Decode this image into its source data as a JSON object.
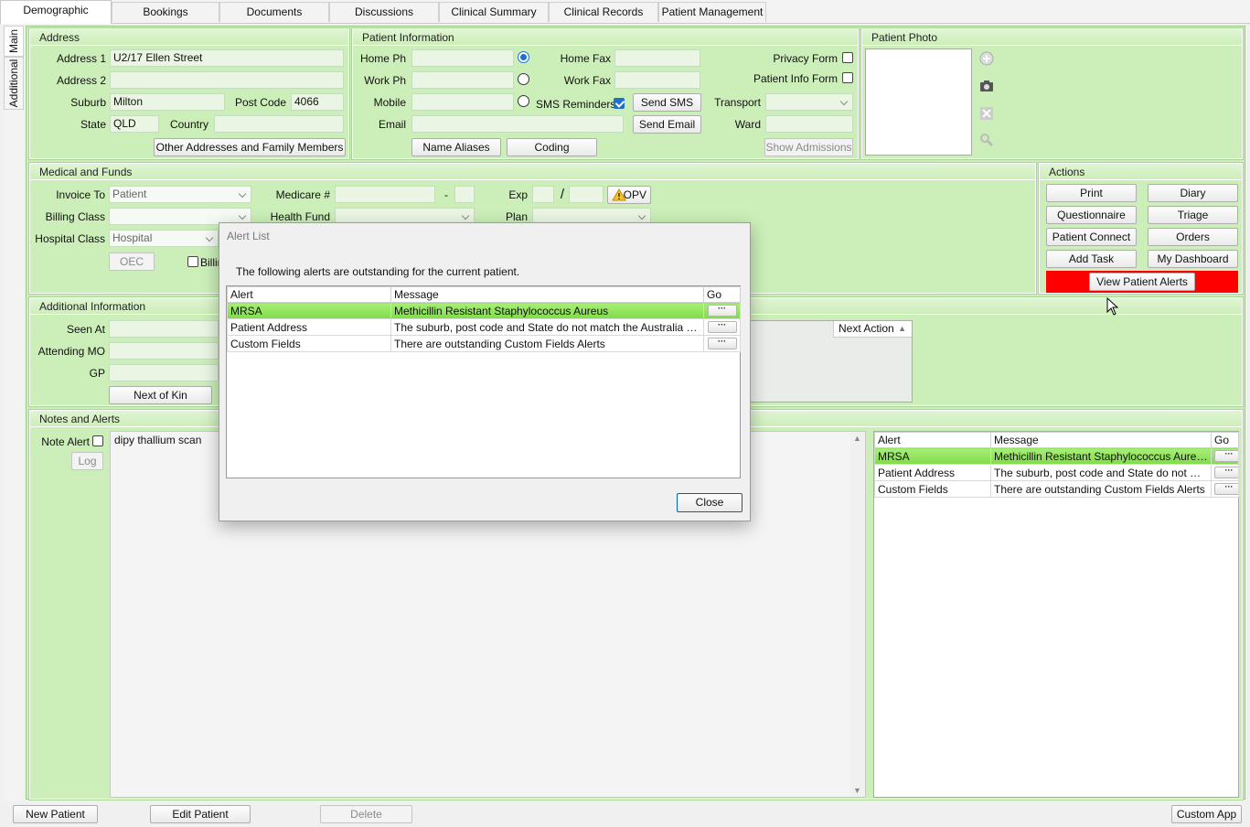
{
  "tabs": [
    "Demographic",
    "Bookings",
    "Documents",
    "Discussions",
    "Clinical Summary",
    "Clinical Records",
    "Patient Management"
  ],
  "side_tabs": [
    "Main",
    "Additional"
  ],
  "address": {
    "title": "Address",
    "address1_label": "Address 1",
    "address1": "U2/17 Ellen Street",
    "address2_label": "Address 2",
    "address2": "",
    "suburb_label": "Suburb",
    "suburb": "Milton",
    "postcode_label": "Post Code",
    "postcode": "4066",
    "state_label": "State",
    "state": "QLD",
    "country_label": "Country",
    "country": "",
    "other_button": "Other Addresses and Family Members"
  },
  "patient_info": {
    "title": "Patient Information",
    "home_ph": "Home Ph",
    "work_ph": "Work Ph",
    "mobile": "Mobile",
    "email": "Email",
    "home_fax": "Home Fax",
    "work_fax": "Work Fax",
    "sms_reminders": "SMS Reminders",
    "send_sms": "Send SMS",
    "send_email": "Send Email",
    "privacy_form": "Privacy Form",
    "patient_info_form": "Patient Info Form",
    "transport": "Transport",
    "ward": "Ward",
    "show_admissions": "Show Admissions",
    "name_aliases": "Name Aliases",
    "coding": "Coding"
  },
  "photo": {
    "title": "Patient Photo"
  },
  "medical": {
    "title": "Medical and Funds",
    "invoice_to_label": "Invoice To",
    "invoice_to": "Patient",
    "billing_class": "Billing Class",
    "hospital_class_label": "Hospital Class",
    "hospital_class": "Hospital",
    "medicare": "Medicare #",
    "health_fund": "Health Fund",
    "exp": "Exp",
    "plan": "Plan",
    "opv": "OPV",
    "oec": "OEC",
    "billing_chk": "Billin",
    "dash": "-",
    "slash": "/"
  },
  "actions": {
    "title": "Actions",
    "buttons": [
      "Print",
      "Diary",
      "Questionnaire",
      "Triage",
      "Patient Connect",
      "Orders",
      "Add Task",
      "My Dashboard"
    ],
    "view_alerts": "View Patient Alerts"
  },
  "additional": {
    "title": "Additional Information",
    "seen_at": "Seen At",
    "attending_mo": "Attending MO",
    "gp": "GP",
    "next_of_kin": "Next of Kin",
    "next_action": "Next Action"
  },
  "notes": {
    "title": "Notes and Alerts",
    "note_alert": "Note Alert",
    "log": "Log",
    "text": "dipy thallium scan"
  },
  "alerts": {
    "headers": [
      "Alert",
      "Message",
      "Go"
    ],
    "rows": [
      {
        "alert": "MRSA",
        "message": "Methicillin Resistant Staphylococcus Aureus",
        "go": "···"
      },
      {
        "alert": "Patient Address",
        "message": "The suburb, post code and State do not match the Australia Post da...",
        "go": "···"
      },
      {
        "alert": "Custom Fields",
        "message": "There are outstanding Custom Fields Alerts",
        "go": "···"
      }
    ]
  },
  "alerts_right": {
    "rows": [
      {
        "alert": "MRSA",
        "message": "Methicillin Resistant Staphylococcus Aureus",
        "go": "···"
      },
      {
        "alert": "Patient Address",
        "message": "The suburb, post code and State do not match ...",
        "go": "···"
      },
      {
        "alert": "Custom Fields",
        "message": "There are outstanding Custom Fields Alerts",
        "go": "···"
      }
    ]
  },
  "dialog": {
    "title": "Alert List",
    "intro": "The following alerts are outstanding for the current patient.",
    "close": "Close"
  },
  "bottom": {
    "new_patient": "New Patient",
    "edit_patient": "Edit Patient",
    "delete": "Delete",
    "custom_app": "Custom App"
  },
  "colors": {
    "panel": "#ccefb9",
    "alert_red": "#ff0000",
    "row_green": "#8fe05a"
  }
}
